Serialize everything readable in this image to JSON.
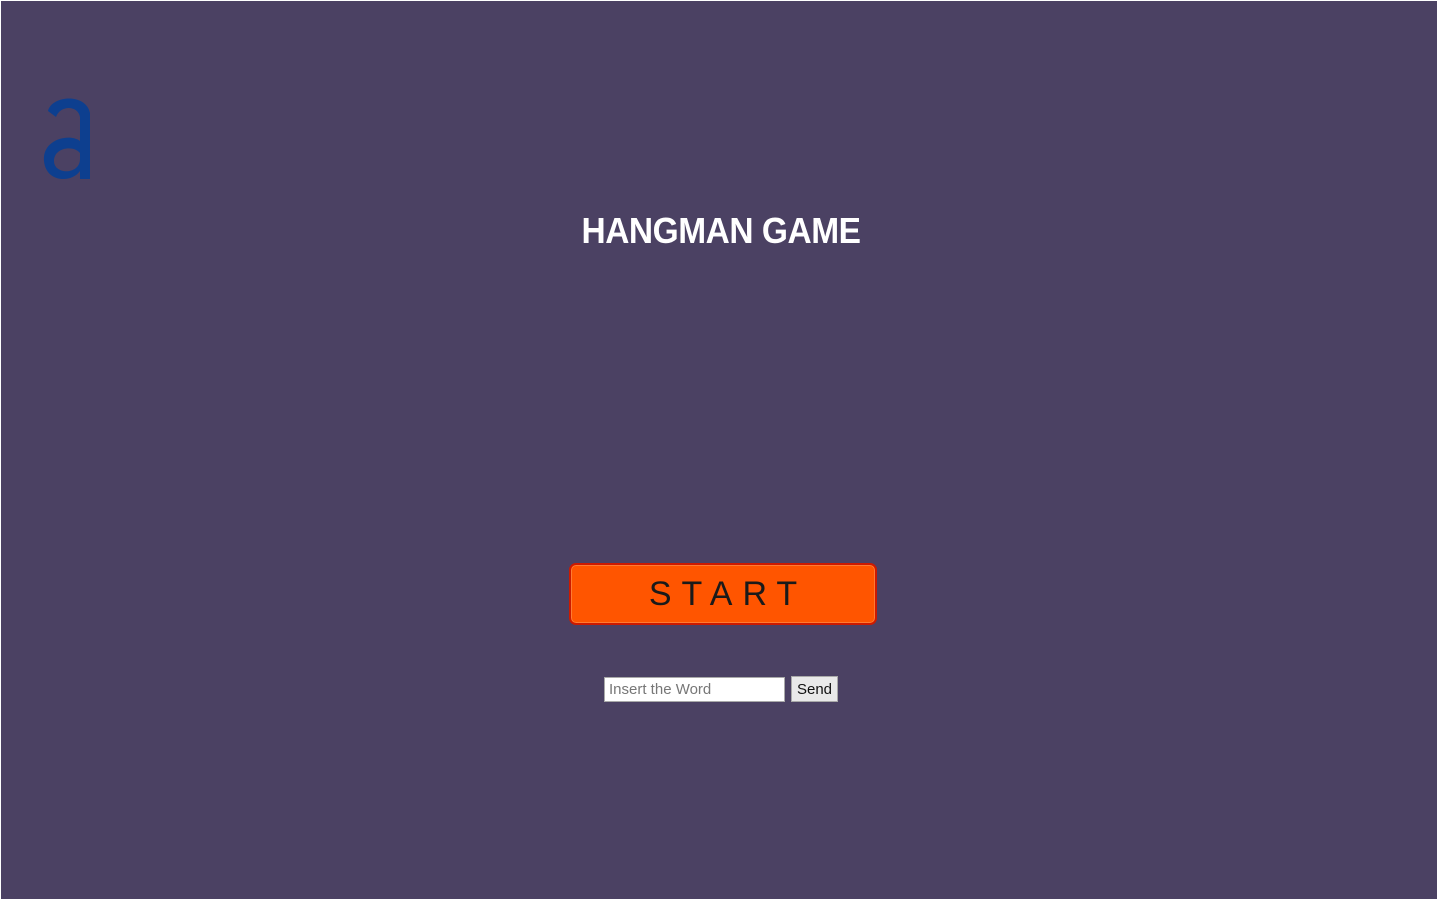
{
  "game": {
    "title": "HANGMAN GAME",
    "start_label": "START"
  },
  "logo": {
    "icon": "letter-a-logo",
    "color": "#0d3f8f"
  },
  "word_form": {
    "input_value": "",
    "input_placeholder": "Insert the Word",
    "send_label": "Send"
  },
  "colors": {
    "background": "#4b4163",
    "start_button": "#ff5500",
    "start_button_border": "#cc1a00",
    "title_text": "#ffffff"
  }
}
